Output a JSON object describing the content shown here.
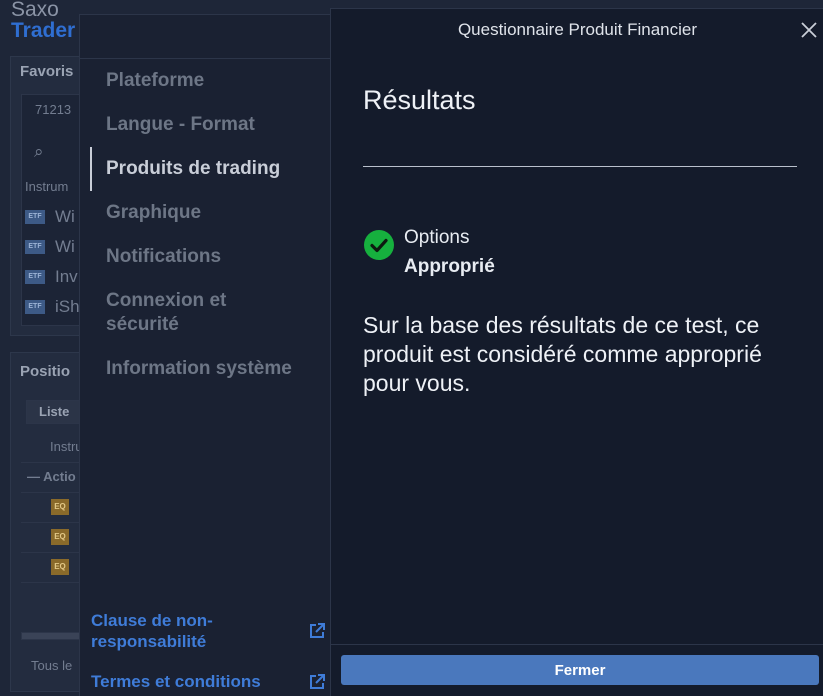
{
  "background_app": {
    "brand_line1": "Saxo",
    "brand_line2": "Trader",
    "favorites_title": "Favoris",
    "favorites_field": "71213",
    "instruments_label": "Instrum",
    "etf_badge": "ETF",
    "favorite_rows": [
      "Wi",
      "Wi",
      "Inv",
      "iSh"
    ],
    "positions_title": "Positio",
    "list_button": "Liste",
    "instrument_header": "Instru",
    "group_label": "— Actio",
    "eq_badge": "EQ",
    "footer_text": "Tous le"
  },
  "settings_menu": {
    "items": [
      {
        "label": "Plateforme",
        "active": false
      },
      {
        "label": "Langue - Format",
        "active": false
      },
      {
        "label": "Produits de trading",
        "active": true
      },
      {
        "label": "Graphique",
        "active": false
      },
      {
        "label": "Notifications",
        "active": false
      },
      {
        "label": "Connexion et sécurité",
        "active": false
      },
      {
        "label": "Information système",
        "active": false
      }
    ],
    "footer_links": [
      {
        "label": "Clause de non-responsabilité",
        "icon": "external-link-icon"
      },
      {
        "label": "Termes et conditions",
        "icon": "external-link-icon"
      }
    ]
  },
  "dialog": {
    "title": "Questionnaire Produit Financier",
    "close_icon": "close-icon",
    "header": "Résultats",
    "result": {
      "icon": "check-circle-icon",
      "name": "Options",
      "status": "Approprié",
      "status_color": "#16b03e"
    },
    "description": "Sur la base des résultats de ce test, ce produit est considéré comme approprié pour vous.",
    "button_label": "Fermer",
    "button_color": "#4a78bd"
  }
}
